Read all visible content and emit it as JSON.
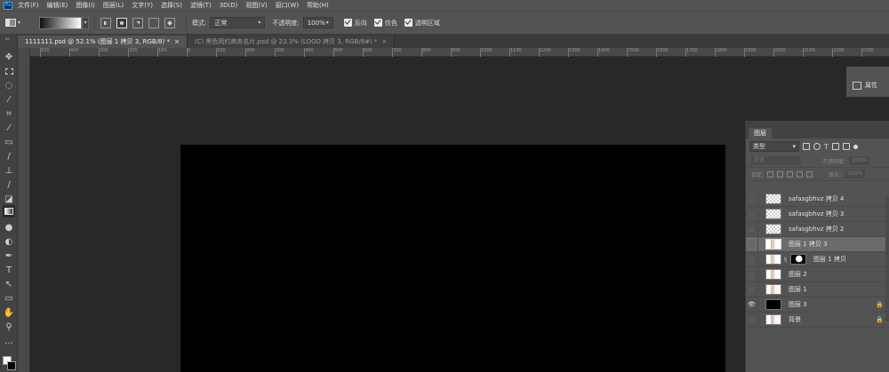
{
  "menu": {
    "logo": "Ps",
    "items": [
      "文件(F)",
      "编辑(E)",
      "图像(I)",
      "图层(L)",
      "文字(Y)",
      "选择(S)",
      "滤镜(T)",
      "3D(D)",
      "视图(V)",
      "窗口(W)",
      "帮助(H)"
    ]
  },
  "options": {
    "mode_label": "模式:",
    "mode_value": "正常",
    "opacity_label": "不透明度:",
    "opacity_value": "100%",
    "reverse_label": "反向",
    "dither_label": "仿色",
    "transparency_label": "透明区域"
  },
  "tabs": [
    {
      "label": "1111111.psd @ 52.1% (图层 1 拷贝 3, RGB/8) *",
      "close": "×"
    },
    {
      "label": "(C) 黑色简约商务名片.psd @ 23.3% (LOGO 拷贝 3, RGB/8#) *",
      "close": "×"
    }
  ],
  "ruler": {
    "ticks": [
      "500",
      "400",
      "300",
      "200",
      "100",
      "0",
      "100",
      "200",
      "300",
      "400",
      "500",
      "600",
      "700",
      "800",
      "900",
      "1000",
      "1100",
      "1200",
      "1300",
      "1400",
      "1500",
      "1600",
      "1700",
      "1800",
      "1900",
      "2000",
      "2100",
      "2200",
      "2300"
    ]
  },
  "properties": {
    "label": "属性"
  },
  "layers": {
    "tab": "图层",
    "filter_kind": "类型",
    "blend_mode": "正常",
    "opacity_label": "不透明度:",
    "opacity_value": "100%",
    "lock_label": "锁定:",
    "fill_label": "填充:",
    "fill_value": "100%",
    "items": [
      {
        "name": "safasgbhvz 拷贝 4"
      },
      {
        "name": "safasgbhvz 拷贝 3"
      },
      {
        "name": "safasgbhvz 拷贝 2"
      },
      {
        "name": "图层 1 拷贝 3"
      },
      {
        "name": "图层 1 拷贝"
      },
      {
        "name": "图层 2"
      },
      {
        "name": "图层 1"
      },
      {
        "name": "图层 3"
      },
      {
        "name": "背景"
      }
    ]
  },
  "colors": {
    "foreground": "#ffffff",
    "background": "#000000"
  }
}
